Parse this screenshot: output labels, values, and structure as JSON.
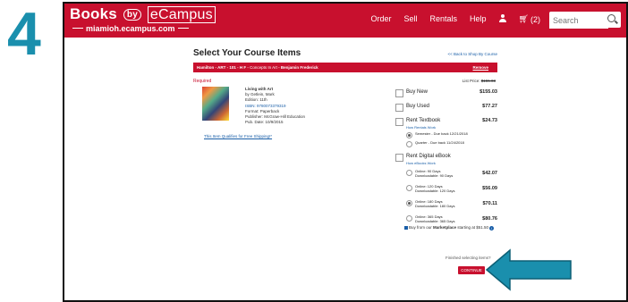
{
  "step_number": "4",
  "header": {
    "logo_books": "Books",
    "logo_by": "by",
    "logo_ecampus": "eCampus",
    "subdomain": "miamioh.ecampus.com",
    "nav": [
      "Order",
      "Sell",
      "Rentals",
      "Help"
    ],
    "cart_count": "(2)",
    "search_placeholder": "Search"
  },
  "page": {
    "title": "Select Your Course Items",
    "back_link": "<< Back to Shop By Course",
    "course_prefix": "Hamilton - ART - 101 - H F - ",
    "course_name": "Concepts In Art",
    "course_instructor": " - Benjamin Frederick",
    "remove_label": "Remove",
    "required_label": "Required",
    "list_price_label": "List Price: ",
    "list_price_value": "$155.03"
  },
  "book": {
    "title": "Living with Art",
    "author": "by Getlein, Mark",
    "edition": "Edition: 11th",
    "isbn": "ISBN: 9780073379319",
    "format": "Format: Paperback",
    "publisher": "Publisher: McGraw-Hill Education",
    "pub_date": "Pub. Date: 10/9/2015",
    "free_shipping": "This Item Qualifies for Free Shipping!*"
  },
  "options": {
    "buy_new": {
      "label": "Buy New",
      "price": "$155.03"
    },
    "buy_used": {
      "label": "Buy Used",
      "price": "$77.27"
    },
    "rent_textbook": {
      "label": "Rent Textbook",
      "price": "$24.73",
      "link": "How Rentals Work",
      "terms": [
        {
          "label": "Semester - Due back 12/21/2018",
          "selected": true
        },
        {
          "label": "Quarter - Due back 11/24/2018",
          "selected": false
        }
      ]
    },
    "rent_ebook": {
      "label": "Rent Digital eBook",
      "link": "How eBooks Work",
      "terms": [
        {
          "line1": "Online: 90 Days",
          "line2": "Downloadable: 90 Days",
          "price": "$42.07",
          "selected": false
        },
        {
          "line1": "Online: 120 Days",
          "line2": "Downloadable: 120 Days",
          "price": "$56.09",
          "selected": false
        },
        {
          "line1": "Online: 180 Days",
          "line2": "Downloadable: 180 Days",
          "price": "$70.11",
          "selected": true
        },
        {
          "line1": "Online: 365 Days",
          "line2": "Downloadable: 365 Days",
          "price": "$80.76",
          "selected": false
        }
      ]
    }
  },
  "marketplace": {
    "prefix": "Buy from our ",
    "bold": "Marketplace",
    "suffix": " starting at $51.50"
  },
  "footer": {
    "finished_text": "Finished selecting items?",
    "continue_label": "CONTINUE"
  },
  "colors": {
    "brand_red": "#c8102e",
    "step_teal": "#1a8fad",
    "link_blue": "#1a5fa8"
  }
}
